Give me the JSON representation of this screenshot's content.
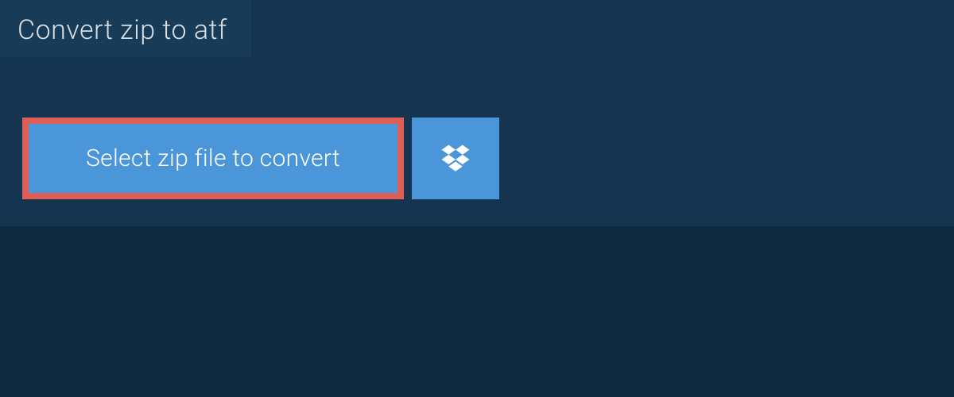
{
  "tab": {
    "title": "Convert zip to atf"
  },
  "actions": {
    "select_file_label": "Select zip file to convert"
  },
  "colors": {
    "page_bg": "#0f2940",
    "panel_bg": "#14344f",
    "tab_bg": "#183b58",
    "button_bg": "#4b95d9",
    "highlight_border": "#dd5e57",
    "text_light": "#d7dde2",
    "text_white": "#ffffff"
  }
}
